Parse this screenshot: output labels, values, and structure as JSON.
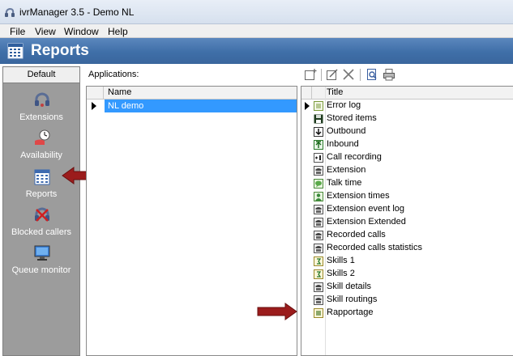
{
  "window": {
    "title": "ivrManager 3.5 - Demo NL"
  },
  "menu": [
    "File",
    "View",
    "Window",
    "Help"
  ],
  "header": {
    "title": "Reports"
  },
  "sidebar": {
    "tab": "Default",
    "items": [
      {
        "label": "Extensions",
        "icon": "extensions-icon"
      },
      {
        "label": "Availability",
        "icon": "availability-icon"
      },
      {
        "label": "Reports",
        "icon": "reports-icon"
      },
      {
        "label": "Blocked callers",
        "icon": "blocked-callers-icon"
      },
      {
        "label": "Queue monitor",
        "icon": "queue-monitor-icon"
      }
    ]
  },
  "applications": {
    "label": "Applications:",
    "column": "Name",
    "rows": [
      "NL demo"
    ]
  },
  "reports": {
    "column": "Title",
    "rows": [
      "Error log",
      "Stored items",
      "Outbound",
      "Inbound",
      "Call recording",
      "Extension",
      "Talk time",
      "Extension times",
      "Extension event log",
      "Extension Extended",
      "Recorded calls",
      "Recorded calls statistics",
      "Skills 1",
      "Skills 2",
      "Skill details",
      "Skill routings",
      "Rapportage"
    ]
  },
  "colors": {
    "header": "#3f6fa8",
    "selection": "#3399ff",
    "sidebar": "#9c9c9c",
    "arrow": "#9b1c1c"
  }
}
